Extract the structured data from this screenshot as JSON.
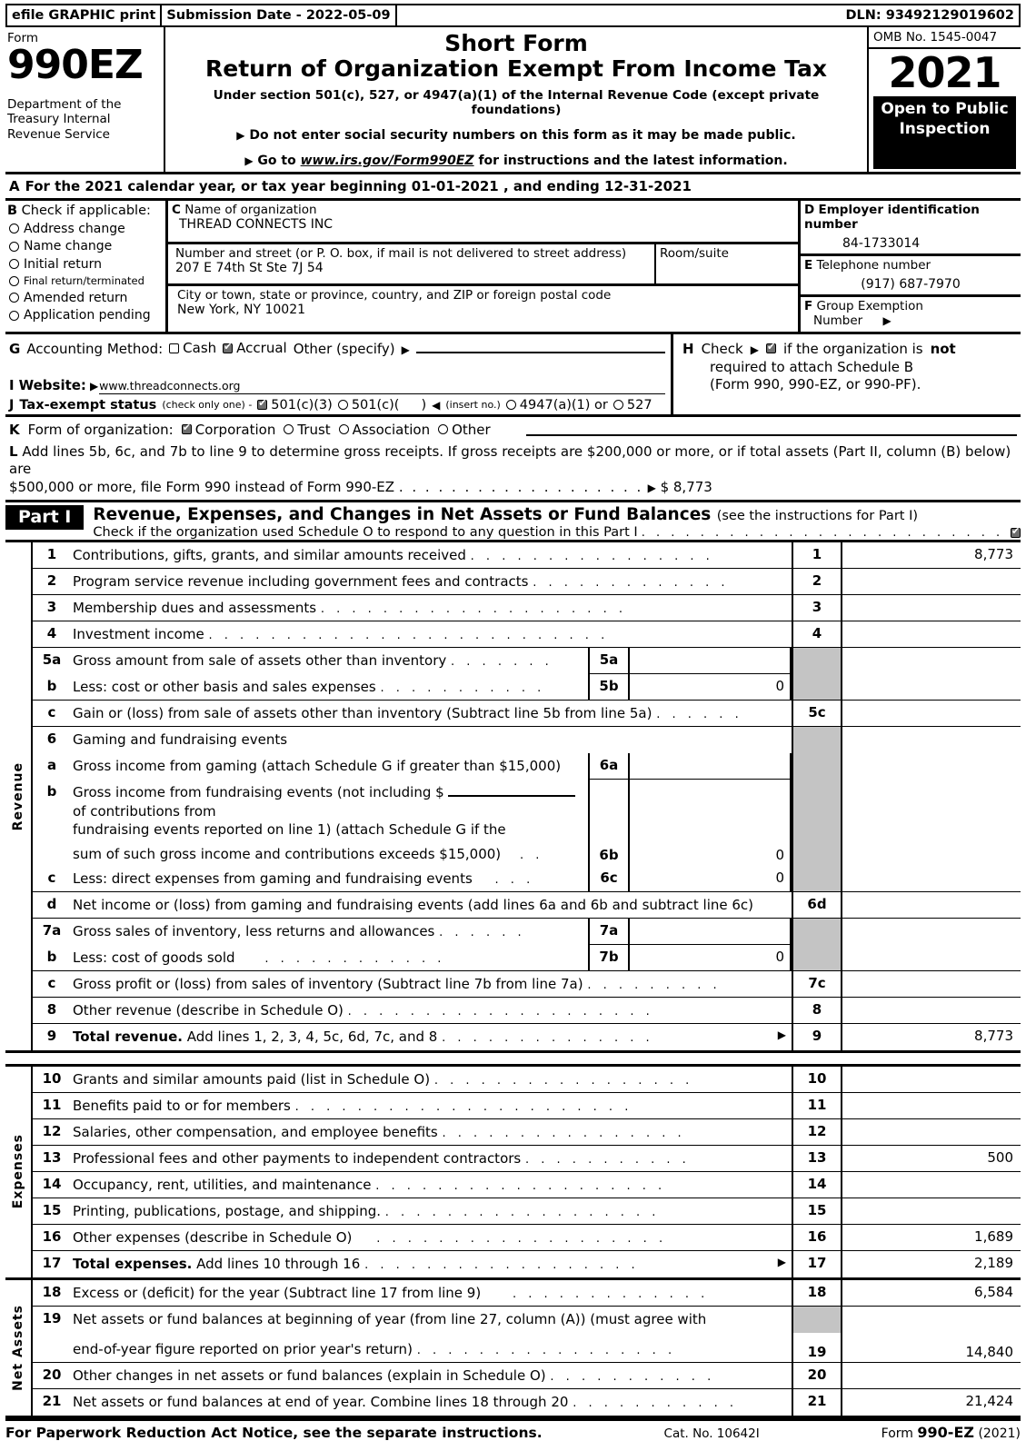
{
  "efile": {
    "print_label": "efile GRAPHIC print",
    "submission": "Submission Date - 2022-05-09",
    "dln": "DLN: 93492129019602"
  },
  "header": {
    "form_label": "Form",
    "form_number": "990EZ",
    "department": "Department of the Treasury Internal Revenue Service",
    "title_line1": "Short Form",
    "title_line2": "Return of Organization Exempt From Income Tax",
    "subtitle": "Under section 501(c), 527, or 4947(a)(1) of the Internal Revenue Code (except private foundations)",
    "bullet1": "Do not enter social security numbers on this form as it may be made public.",
    "bullet2_pre": "Go to",
    "bullet2_link": "www.irs.gov/Form990EZ",
    "bullet2_post": "for instructions and the latest information.",
    "omb": "OMB No. 1545-0047",
    "year": "2021",
    "open_to_public": "Open to Public Inspection"
  },
  "lineA": {
    "letter": "A",
    "text": "For the 2021 calendar year, or tax year beginning 01-01-2021 , and ending 12-31-2021"
  },
  "lineB": {
    "letter": "B",
    "heading": "Check if applicable:",
    "options": [
      {
        "label": "Address change",
        "checked": false,
        "small": false
      },
      {
        "label": "Name change",
        "checked": false,
        "small": false
      },
      {
        "label": "Initial return",
        "checked": false,
        "small": false
      },
      {
        "label": "Final return/terminated",
        "checked": false,
        "small": true
      },
      {
        "label": "Amended return",
        "checked": false,
        "small": false
      },
      {
        "label": "Application pending",
        "checked": false,
        "small": false
      }
    ]
  },
  "lineC": {
    "letter": "C",
    "name_label": "Name of organization",
    "name_value": "THREAD CONNECTS INC",
    "street_label": "Number and street (or P. O. box, if mail is not delivered to street address)",
    "street_value": "207 E 74th St Ste 7J 54",
    "room_label": "Room/suite",
    "room_value": "",
    "city_label": "City or town, state or province, country, and ZIP or foreign postal code",
    "city_value": "New York, NY   10021"
  },
  "lineD": {
    "letter": "D",
    "label": "Employer identification number",
    "value": "84-1733014"
  },
  "lineE": {
    "letter": "E",
    "label": "Telephone number",
    "value": "(917) 687-7970"
  },
  "lineF": {
    "letter": "F",
    "label_1": "Group Exemption",
    "label_2": "Number",
    "value": ""
  },
  "lineG": {
    "letter": "G",
    "label": "Accounting Method:",
    "cash": "Cash",
    "cash_checked": false,
    "accrual": "Accrual",
    "accrual_checked": true,
    "other": "Other (specify)",
    "other_value": ""
  },
  "lineH": {
    "letter": "H",
    "check_label": "Check",
    "checked": true,
    "text_1a": "if the organization is",
    "text_1b": "not",
    "text_2": "required to attach Schedule B",
    "text_3": "(Form 990, 990-EZ, or 990-PF)."
  },
  "lineI": {
    "letter": "I",
    "label": "Website:",
    "value": "www.threadconnects.org"
  },
  "lineJ": {
    "letter": "J",
    "label": "Tax-exempt status",
    "note": "(check only one) -",
    "opt1": "501(c)(3)",
    "opt1_checked": true,
    "opt2": "501(c)(",
    "opt2_checked": false,
    "opt2_suffix": ")",
    "insert_no": "(insert no.)",
    "opt3": "4947(a)(1) or",
    "opt3_checked": false,
    "opt4": "527",
    "opt4_checked": false
  },
  "lineK": {
    "letter": "K",
    "label": "Form of organization:",
    "options": [
      {
        "label": "Corporation",
        "checked": true
      },
      {
        "label": "Trust",
        "checked": false
      },
      {
        "label": "Association",
        "checked": false
      },
      {
        "label": "Other",
        "checked": false
      }
    ]
  },
  "lineL": {
    "letter": "L",
    "text_1": "Add lines 5b, 6c, and 7b to line 9 to determine gross receipts. If gross receipts are $200,000 or more, or if total assets (Part II, column (B) below) are",
    "text_2": "$500,000 or more, file Form 990 instead of Form 990-EZ",
    "value": "$ 8,773"
  },
  "part1": {
    "tag": "Part I",
    "title": "Revenue, Expenses, and Changes in Net Assets or Fund Balances",
    "title_note": "(see the instructions for Part I)",
    "schedule_o": "Check if the organization used Schedule O to respond to any question in this Part I",
    "schedule_o_checked": true,
    "section_revenue": "Revenue",
    "section_expenses": "Expenses",
    "section_netassets": "Net Assets"
  },
  "rows": {
    "r1": {
      "no": "1",
      "desc": "Contributions, gifts, grants, and similar amounts received",
      "key": "1",
      "amount": "8,773"
    },
    "r2": {
      "no": "2",
      "desc": "Program service revenue including government fees and contracts",
      "key": "2",
      "amount": ""
    },
    "r3": {
      "no": "3",
      "desc": "Membership dues and assessments",
      "key": "3",
      "amount": ""
    },
    "r4": {
      "no": "4",
      "desc": "Investment income",
      "key": "4",
      "amount": ""
    },
    "r5a": {
      "no": "5a",
      "desc": "Gross amount from sale of assets other than inventory",
      "subkey": "5a",
      "subamount": ""
    },
    "r5b": {
      "no": "b",
      "desc": "Less: cost or other basis and sales expenses",
      "subkey": "5b",
      "subamount": "0"
    },
    "r5c": {
      "no": "c",
      "desc": "Gain or (loss) from sale of assets other than inventory (Subtract line 5b from line 5a)",
      "key": "5c",
      "amount": ""
    },
    "r6": {
      "no": "6",
      "desc": "Gaming and fundraising events"
    },
    "r6a": {
      "no": "a",
      "desc": "Gross income from gaming (attach Schedule G if greater than $15,000)",
      "subkey": "6a",
      "subamount": ""
    },
    "r6b": {
      "no": "b",
      "desc_1": "Gross income from fundraising events (not including $",
      "desc_2": "of contributions from",
      "desc_3": "fundraising events reported on line 1) (attach Schedule G if the",
      "desc_4": "sum of such gross income and contributions exceeds $15,000)",
      "subkey": "6b",
      "subamount": "0"
    },
    "r6c": {
      "no": "c",
      "desc": "Less: direct expenses from gaming and fundraising events",
      "subkey": "6c",
      "subamount": "0"
    },
    "r6d": {
      "no": "d",
      "desc": "Net income or (loss) from gaming and fundraising events (add lines 6a and 6b and subtract line 6c)",
      "key": "6d",
      "amount": ""
    },
    "r7a": {
      "no": "7a",
      "desc": "Gross sales of inventory, less returns and allowances",
      "subkey": "7a",
      "subamount": ""
    },
    "r7b": {
      "no": "b",
      "desc": "Less: cost of goods sold",
      "subkey": "7b",
      "subamount": "0"
    },
    "r7c": {
      "no": "c",
      "desc": "Gross profit or (loss) from sales of inventory (Subtract line 7b from line 7a)",
      "key": "7c",
      "amount": ""
    },
    "r8": {
      "no": "8",
      "desc": "Other revenue (describe in Schedule O)",
      "key": "8",
      "amount": ""
    },
    "r9": {
      "no": "9",
      "desc_bold": "Total revenue.",
      "desc": "Add lines 1, 2, 3, 4, 5c, 6d, 7c, and 8",
      "key": "9",
      "amount": "8,773"
    },
    "r10": {
      "no": "10",
      "desc": "Grants and similar amounts paid (list in Schedule O)",
      "key": "10",
      "amount": ""
    },
    "r11": {
      "no": "11",
      "desc": "Benefits paid to or for members",
      "key": "11",
      "amount": ""
    },
    "r12": {
      "no": "12",
      "desc": "Salaries, other compensation, and employee benefits",
      "key": "12",
      "amount": ""
    },
    "r13": {
      "no": "13",
      "desc": "Professional fees and other payments to independent contractors",
      "key": "13",
      "amount": "500"
    },
    "r14": {
      "no": "14",
      "desc": "Occupancy, rent, utilities, and maintenance",
      "key": "14",
      "amount": ""
    },
    "r15": {
      "no": "15",
      "desc": "Printing, publications, postage, and shipping.",
      "key": "15",
      "amount": ""
    },
    "r16": {
      "no": "16",
      "desc": "Other expenses (describe in Schedule O)",
      "key": "16",
      "amount": "1,689"
    },
    "r17": {
      "no": "17",
      "desc_bold": "Total expenses.",
      "desc": "Add lines 10 through 16",
      "key": "17",
      "amount": "2,189"
    },
    "r18": {
      "no": "18",
      "desc": "Excess or (deficit) for the year (Subtract line 17 from line 9)",
      "key": "18",
      "amount": "6,584"
    },
    "r19": {
      "no": "19",
      "desc_1": "Net assets or fund balances at beginning of year (from line 27, column (A)) (must agree with",
      "desc_2": "end-of-year figure reported on prior year's return)",
      "key": "19",
      "amount": "14,840"
    },
    "r20": {
      "no": "20",
      "desc": "Other changes in net assets or fund balances (explain in Schedule O)",
      "key": "20",
      "amount": ""
    },
    "r21": {
      "no": "21",
      "desc": "Net assets or fund balances at end of year. Combine lines 18 through 20",
      "key": "21",
      "amount": "21,424"
    }
  },
  "footer": {
    "notice": "For Paperwork Reduction Act Notice, see the separate instructions.",
    "cat": "Cat. No. 10642I",
    "form_pre": "Form",
    "form_bold": "990-EZ",
    "form_year": "(2021)"
  }
}
